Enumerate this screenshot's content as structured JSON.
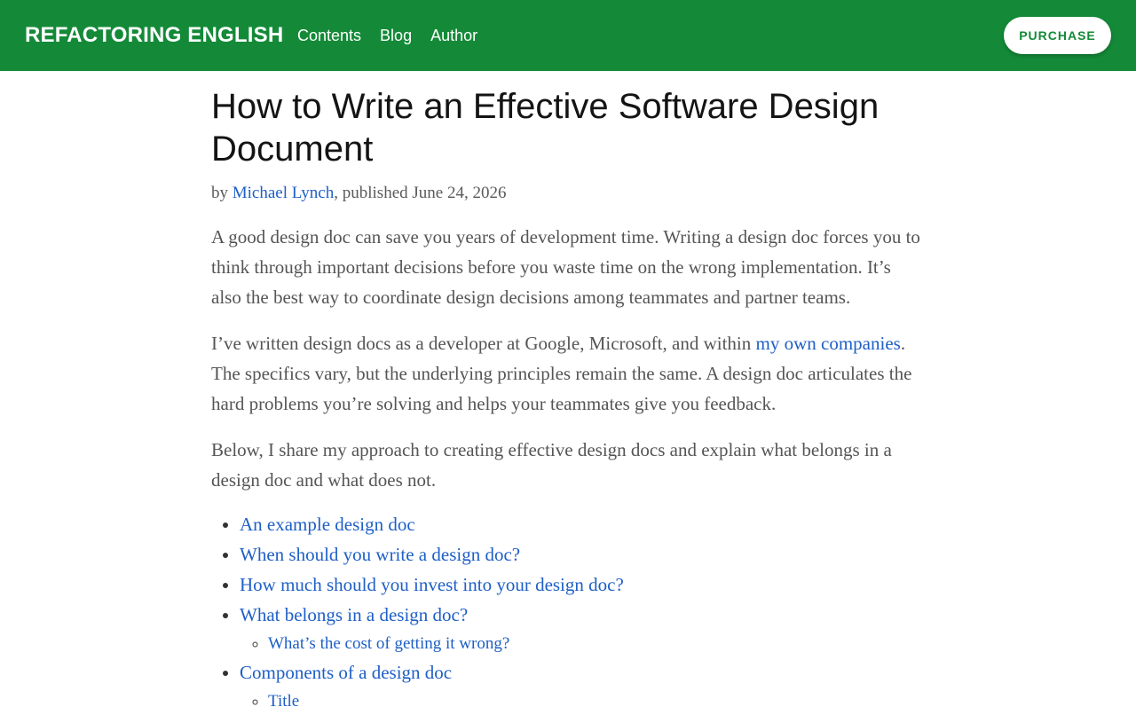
{
  "header": {
    "brand": "REFACTORING ENGLISH",
    "nav": [
      "Contents",
      "Blog",
      "Author"
    ],
    "purchase_label": "PURCHASE",
    "color": "#148a38"
  },
  "article": {
    "title": "How to Write an Effective Software Design Document",
    "byline": {
      "prefix": "by ",
      "author": "Michael Lynch",
      "suffix": ", published June 24, 2026"
    },
    "para1": "A good design doc can save you years of development time. Writing a design doc forces you to think through important decisions before you waste time on the wrong implementation. It’s also the best way to coordinate design decisions among teammates and partner teams.",
    "para2": {
      "before": "I’ve written design docs as a developer at Google, Microsoft, and within ",
      "link": "my own companies",
      "after": ". The specifics vary, but the underlying principles remain the same. A design doc articulates the hard problems you’re solving and helps your teammates give you feedback."
    },
    "para3": "Below, I share my approach to creating effective design docs and explain what belongs in a design doc and what does not.",
    "toc": {
      "item1": "An example design doc",
      "item2": "When should you write a design doc?",
      "item3": "How much should you invest into your design doc?",
      "item4": "What belongs in a design doc?",
      "item4_sub1": "What’s the cost of getting it wrong?",
      "item5": "Components of a design doc",
      "item5_sub1": "Title"
    }
  }
}
